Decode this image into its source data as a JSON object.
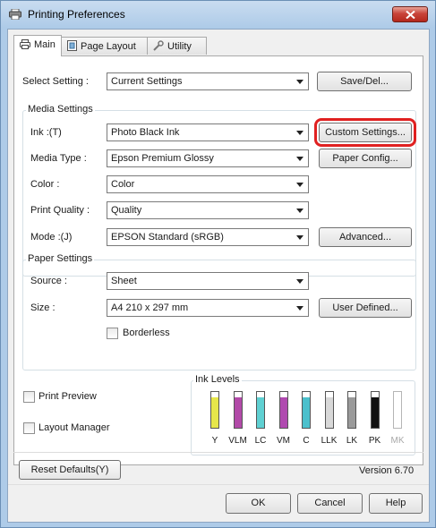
{
  "window": {
    "title": "Printing Preferences"
  },
  "tabs": [
    {
      "label": "Main",
      "icon": "printer-icon"
    },
    {
      "label": "Page Layout",
      "icon": "page-layout-icon"
    },
    {
      "label": "Utility",
      "icon": "wrench-icon"
    }
  ],
  "select_setting": {
    "label": "Select Setting :",
    "value": "Current Settings",
    "save_label": "Save/Del..."
  },
  "media_settings": {
    "title": "Media Settings",
    "ink": {
      "label": "Ink :(T)",
      "value": "Photo Black Ink"
    },
    "custom_settings_label": "Custom Settings...",
    "media_type": {
      "label": "Media Type :",
      "value": "Epson Premium Glossy"
    },
    "paper_config_label": "Paper Config...",
    "color": {
      "label": "Color :",
      "value": "Color"
    },
    "print_quality": {
      "label": "Print Quality :",
      "value": "Quality"
    },
    "mode": {
      "label": "Mode :(J)",
      "value": "EPSON Standard (sRGB)"
    },
    "advanced_label": "Advanced..."
  },
  "paper_settings": {
    "title": "Paper Settings",
    "source": {
      "label": "Source :",
      "value": "Sheet"
    },
    "size": {
      "label": "Size :",
      "value": "A4 210 x 297 mm"
    },
    "user_defined_label": "User Defined...",
    "borderless_label": "Borderless",
    "borderless_checked": false
  },
  "options": {
    "print_preview_label": "Print Preview",
    "print_preview_checked": false,
    "layout_manager_label": "Layout Manager",
    "layout_manager_checked": false
  },
  "ink_levels": {
    "title": "Ink Levels",
    "inks": [
      {
        "code": "Y",
        "color": "#e6e64a",
        "level": 0.85,
        "enabled": true
      },
      {
        "code": "VLM",
        "color": "#b24aa8",
        "level": 0.85,
        "enabled": true
      },
      {
        "code": "LC",
        "color": "#5fd0d2",
        "level": 0.85,
        "enabled": true
      },
      {
        "code": "VM",
        "color": "#b04ab0",
        "level": 0.85,
        "enabled": true
      },
      {
        "code": "C",
        "color": "#4cc0cc",
        "level": 0.85,
        "enabled": true
      },
      {
        "code": "LLK",
        "color": "#d8d8d8",
        "level": 0.85,
        "enabled": true
      },
      {
        "code": "LK",
        "color": "#9a9a9a",
        "level": 0.85,
        "enabled": true
      },
      {
        "code": "PK",
        "color": "#111111",
        "level": 0.85,
        "enabled": true
      },
      {
        "code": "MK",
        "color": "#ffffff",
        "level": 0.85,
        "enabled": false
      }
    ]
  },
  "reset_defaults_label": "Reset Defaults(Y)",
  "version": "Version 6.70",
  "footer": {
    "ok_label": "OK",
    "cancel_label": "Cancel",
    "help_label": "Help"
  }
}
